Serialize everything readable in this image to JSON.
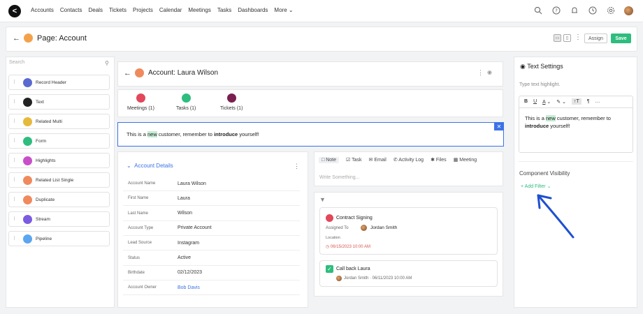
{
  "nav": {
    "links": [
      "Accounts",
      "Contacts",
      "Deals",
      "Tickets",
      "Projects",
      "Calendar",
      "Meetings",
      "Tasks",
      "Dashboards",
      "More"
    ]
  },
  "page": {
    "title": "Page: Account",
    "assign": "Assign",
    "save": "Save"
  },
  "left": {
    "search_placeholder": "Search",
    "components": [
      {
        "label": "Record Header",
        "color": "#5b6ad0"
      },
      {
        "label": "Text",
        "color": "#222"
      },
      {
        "label": "Related Multi",
        "color": "#e6b93a"
      },
      {
        "label": "Form",
        "color": "#2ebd7e"
      },
      {
        "label": "Highlights",
        "color": "#c94fc9"
      },
      {
        "label": "Related List Single",
        "color": "#f08a5d"
      },
      {
        "label": "Duplicate",
        "color": "#f08a5d"
      },
      {
        "label": "Stream",
        "color": "#7b5ce0"
      },
      {
        "label": "Pipeline",
        "color": "#5aa6f0"
      }
    ]
  },
  "account": {
    "title": "Account: Laura Wilson",
    "related": [
      {
        "label": "Meetings (1)",
        "color": "#e2475a"
      },
      {
        "label": "Tasks (1)",
        "color": "#2ebd7e"
      },
      {
        "label": "Tickets (1)",
        "color": "#7a1f4f"
      }
    ],
    "highlight": {
      "pre": "This is a ",
      "new": "new",
      "mid": " customer, remember to ",
      "bold": "introduce",
      "post": " yourself!"
    }
  },
  "details": {
    "title": "Account Details",
    "rows": [
      {
        "label": "Account Name",
        "value": "Laura Wilson"
      },
      {
        "label": "First Name",
        "value": "Laura"
      },
      {
        "label": "Last Name",
        "value": "Wilson"
      },
      {
        "label": "Account Type",
        "value": "Private Account"
      },
      {
        "label": "Lead Source",
        "value": "Instagram"
      },
      {
        "label": "Status",
        "value": "Active"
      },
      {
        "label": "Birthdate",
        "value": "02/12/2023"
      },
      {
        "label": "Account Owner",
        "value": "Bob Davis"
      }
    ]
  },
  "activity": {
    "tabs": [
      "Note",
      "Task",
      "Email",
      "Activity Log",
      "Files",
      "Meeting"
    ],
    "placeholder": "Write Something...",
    "card1": {
      "title": "Contract Signing",
      "assigned_label": "Assigned To",
      "assignee": "Jordan Smith",
      "location_label": "Location",
      "date": "06/15/2023 10:00 AM"
    },
    "card2": {
      "title": "Call back Laura",
      "meta": "Jordan Smith · 06/11/2023 10:00 AM"
    }
  },
  "settings": {
    "title": "Text Settings",
    "placeholder": "Type text highlight.",
    "toolbar": [
      "B",
      "U",
      "A",
      "¶",
      "…"
    ],
    "text": {
      "pre": "This is a ",
      "new": "new",
      "mid": " customer, remember to ",
      "bold": "introduce",
      "post": " yourself!"
    },
    "visibility_title": "Component Visibility",
    "add_filter": "+ Add Filter"
  }
}
